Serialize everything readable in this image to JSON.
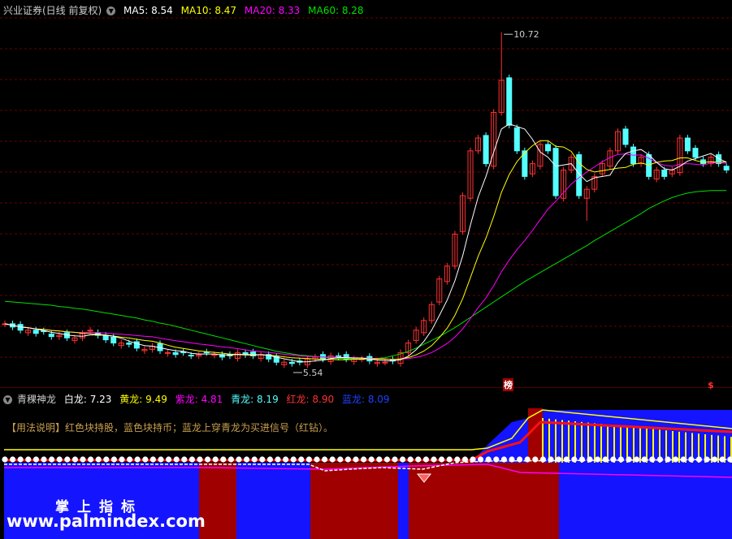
{
  "main_header": {
    "title": "兴业证券(日线 前复权)",
    "ma5_label": "MA5:",
    "ma5": "8.54",
    "ma10_label": "MA10:",
    "ma10": "8.47",
    "ma20_label": "MA20:",
    "ma20": "8.33",
    "ma60_label": "MA60:",
    "ma60": "8.28"
  },
  "annotations": {
    "high": "10.72",
    "low": "5.54",
    "marker1": "榜",
    "marker2": "$"
  },
  "indicator_header": {
    "name": "青稞神龙",
    "white_label": "白龙:",
    "white": "7.23",
    "yellow_label": "黄龙:",
    "yellow": "9.49",
    "purple_label": "紫龙:",
    "purple": "4.81",
    "cyan_label": "青龙:",
    "cyan": "8.19",
    "red_label": "红龙:",
    "red": "8.90",
    "blue_label": "蓝龙:",
    "blue": "8.09"
  },
  "usage_note": "【用法说明】红色块持股，蓝色块持币；蓝龙上穿青龙为买进信号（红钻）。",
  "watermark": {
    "line1": "掌上指标",
    "line2": "www.palmindex.com"
  },
  "colors": {
    "up": "#ff3232",
    "down": "#54ffff",
    "ma5": "#ffffff",
    "ma10": "#ffff00",
    "ma20": "#ff00ff",
    "ma60": "#00e000",
    "hold": "#a00000",
    "cash": "#1414ff"
  },
  "chart_data": {
    "type": "candlestick",
    "title": "兴业证券(日线 前复权)",
    "high_label": 10.72,
    "low_label": 5.54,
    "close": [
      6.2,
      6.15,
      6.1,
      6.1,
      6.05,
      6.08,
      6.0,
      6.02,
      5.98,
      5.98,
      6.05,
      6.1,
      6.02,
      5.95,
      5.9,
      5.9,
      5.88,
      5.82,
      5.8,
      5.85,
      5.78,
      5.75,
      5.72,
      5.75,
      5.7,
      5.72,
      5.75,
      5.72,
      5.68,
      5.7,
      5.75,
      5.72,
      5.7,
      5.72,
      5.65,
      5.6,
      5.6,
      5.58,
      5.6,
      5.65,
      5.68,
      5.65,
      5.7,
      5.68,
      5.65,
      5.65,
      5.65,
      5.62,
      5.6,
      5.6,
      5.62,
      5.75,
      5.9,
      6.1,
      6.25,
      6.5,
      6.9,
      7.1,
      7.6,
      8.2,
      8.9,
      9.1,
      8.7,
      9.5,
      10.0,
      9.3,
      8.9,
      8.5,
      8.7,
      9.0,
      8.9,
      8.2,
      8.6,
      8.8,
      8.2,
      8.3,
      8.5,
      8.7,
      8.9,
      9.2,
      9.0,
      8.7,
      8.8,
      8.5,
      8.6,
      8.5,
      8.6,
      9.1,
      8.9,
      8.8,
      8.7,
      8.8,
      8.7,
      8.6
    ],
    "ma60": [
      6.55,
      6.54,
      6.53,
      6.52,
      6.51,
      6.5,
      6.49,
      6.47,
      6.46,
      6.44,
      6.43,
      6.41,
      6.39,
      6.37,
      6.35,
      6.33,
      6.31,
      6.29,
      6.26,
      6.24,
      6.21,
      6.19,
      6.16,
      6.13,
      6.1,
      6.07,
      6.04,
      6.01,
      5.98,
      5.95,
      5.92,
      5.89,
      5.86,
      5.83,
      5.8,
      5.77,
      5.75,
      5.73,
      5.71,
      5.7,
      5.69,
      5.68,
      5.67,
      5.66,
      5.66,
      5.65,
      5.65,
      5.65,
      5.66,
      5.67,
      5.7,
      5.73,
      5.77,
      5.82,
      5.88,
      5.94,
      6.0,
      6.07,
      6.14,
      6.22,
      6.3,
      6.38,
      6.46,
      6.54,
      6.62,
      6.7,
      6.78,
      6.86,
      6.93,
      7.0,
      7.07,
      7.14,
      7.21,
      7.28,
      7.35,
      7.42,
      7.5,
      7.57,
      7.64,
      7.71,
      7.78,
      7.85,
      7.92,
      8.0,
      8.06,
      8.12,
      8.17,
      8.21,
      8.24,
      8.26,
      8.27,
      8.28,
      8.28,
      8.28
    ]
  }
}
